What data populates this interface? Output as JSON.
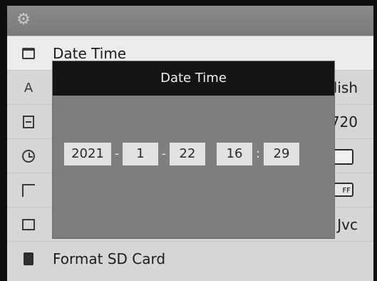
{
  "topbar": {
    "icon": "gear-icon"
  },
  "menu": {
    "items": [
      {
        "icon": "calendar-icon",
        "label": "Date Time",
        "value": ""
      },
      {
        "icon": "language-a-icon",
        "label": "",
        "value": "lish"
      },
      {
        "icon": "film-icon",
        "label": "",
        "value": "720"
      },
      {
        "icon": "clock-icon",
        "label": "",
        "value": ""
      },
      {
        "icon": "ruler-icon",
        "label": "",
        "value": "FF"
      },
      {
        "icon": "camera-icon",
        "label": "",
        "value": "Jvc"
      },
      {
        "icon": "sd-card-icon",
        "label": "Format SD Card",
        "value": ""
      }
    ]
  },
  "dialog": {
    "title": "Date Time",
    "year": "2021",
    "month": "1",
    "day": "22",
    "hour": "16",
    "minute": "29",
    "date_separator": "-",
    "time_separator": ":"
  },
  "colors": {
    "screen_bg": "#d6d6d6",
    "dialog_bg": "#7e7e7e",
    "dialog_header": "#141414",
    "field_bg": "#e2e2e2"
  }
}
